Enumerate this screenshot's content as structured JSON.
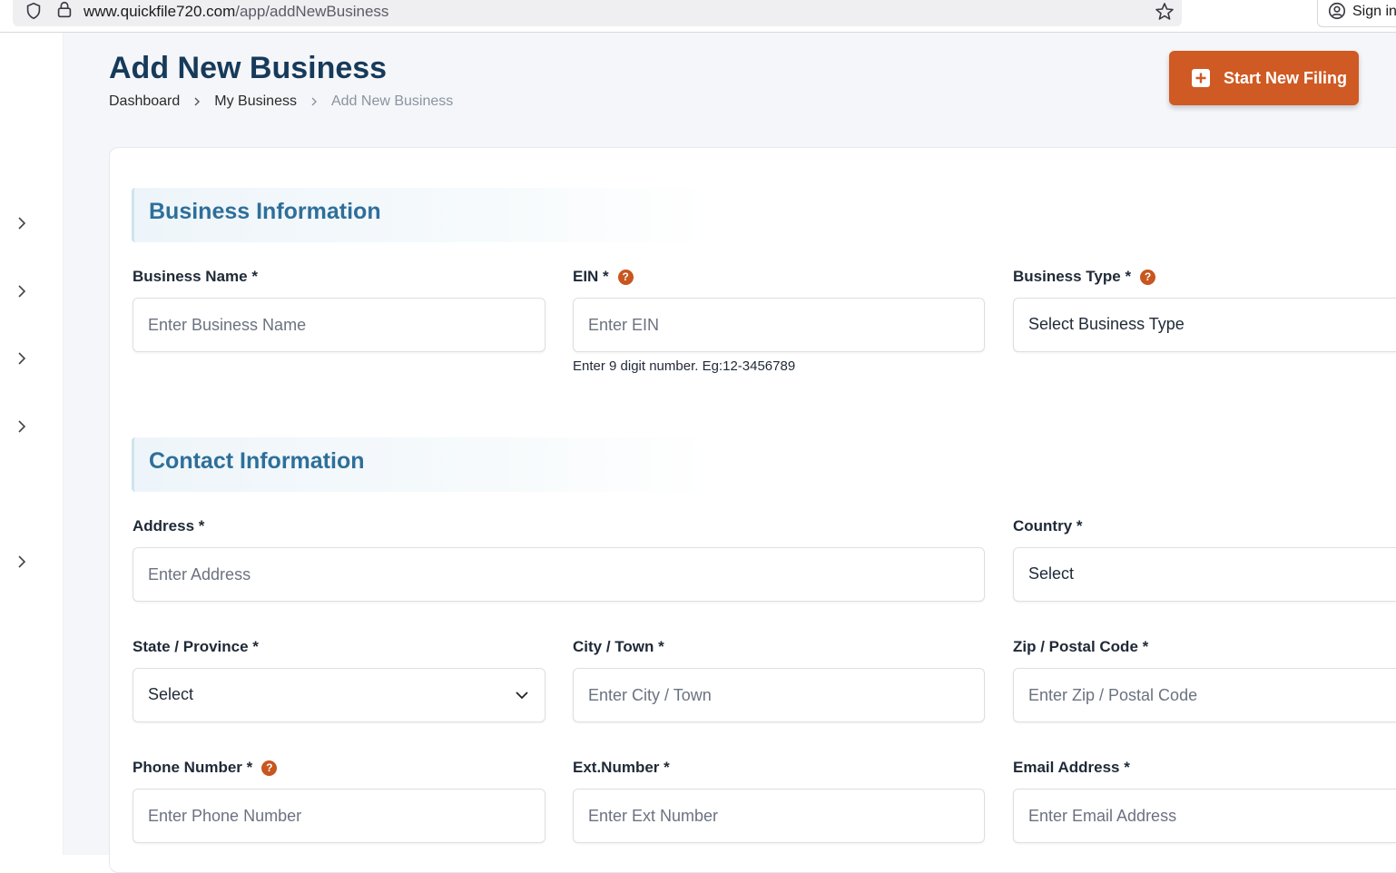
{
  "browser": {
    "url_host": "www.quickfile720.com",
    "url_path": "/app/addNewBusiness",
    "sign_in_label": "Sign in"
  },
  "header": {
    "title": "Add New Business",
    "breadcrumb": [
      "Dashboard",
      "My Business",
      "Add New Business"
    ],
    "cta_label": "Start New Filing"
  },
  "sections": {
    "business": {
      "title": "Business Information",
      "business_name": {
        "label": "Business Name *",
        "placeholder": "Enter Business Name"
      },
      "ein": {
        "label": "EIN *",
        "placeholder": "Enter EIN",
        "hint": "Enter 9 digit number. Eg:12-3456789",
        "help": "?"
      },
      "business_type": {
        "label": "Business Type *",
        "value": "Select Business Type",
        "help": "?"
      }
    },
    "contact": {
      "title": "Contact Information",
      "address": {
        "label": "Address *",
        "placeholder": "Enter Address"
      },
      "country": {
        "label": "Country *",
        "value": "Select"
      },
      "state": {
        "label": "State / Province *",
        "value": "Select"
      },
      "city": {
        "label": "City / Town *",
        "placeholder": "Enter City / Town"
      },
      "zip": {
        "label": "Zip / Postal Code *",
        "placeholder": "Enter Zip / Postal Code"
      },
      "phone": {
        "label": "Phone Number *",
        "placeholder": "Enter Phone Number",
        "help": "?"
      },
      "ext": {
        "label": "Ext.Number *",
        "placeholder": "Enter Ext Number"
      },
      "email": {
        "label": "Email Address *",
        "placeholder": "Enter Email Address"
      }
    }
  },
  "colors": {
    "accent": "#cf5a23",
    "title": "#163a5a",
    "section_title": "#2e6f9a"
  }
}
